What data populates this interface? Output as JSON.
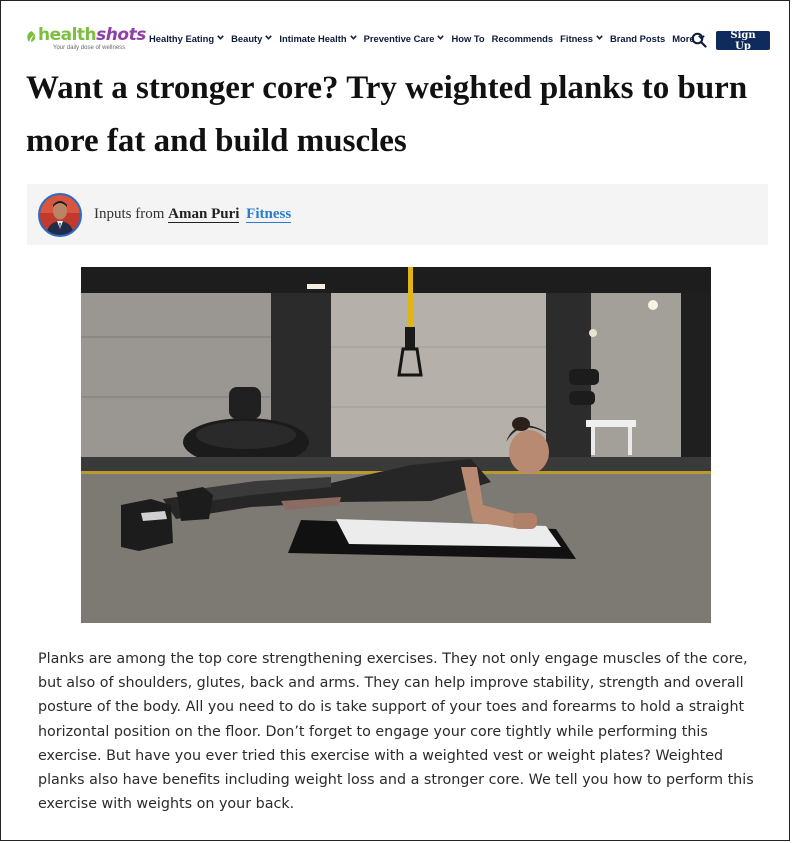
{
  "brand": {
    "name_part1": "health",
    "name_part2": "shots",
    "tagline": "Your daily dose of wellness",
    "green": "#7cbf3f",
    "purple": "#8e3fa8"
  },
  "nav": {
    "items": [
      {
        "label": "Healthy Eating",
        "dropdown": true
      },
      {
        "label": "Beauty",
        "dropdown": true
      },
      {
        "label": "Intimate Health",
        "dropdown": true
      },
      {
        "label": "Preventive Care",
        "dropdown": true
      },
      {
        "label": "How To",
        "dropdown": false
      },
      {
        "label": "Recommends",
        "dropdown": false
      },
      {
        "label": "Fitness",
        "dropdown": true
      },
      {
        "label": "Brand Posts",
        "dropdown": false
      },
      {
        "label": "More",
        "dropdown": true
      }
    ],
    "search_icon": "search-icon",
    "signup_label": "Sign Up",
    "signup_color": "#0f2a5c"
  },
  "article": {
    "headline": "Want a stronger core? Try weighted planks to burn more fat and build muscles",
    "author_prefix": "Inputs from",
    "author_name": "Aman Puri",
    "category": "Fitness",
    "category_color": "#2a7bd0",
    "body": "Planks are among the top core strengthening exercises. They not only engage muscles of the core, but also of shoulders, glutes, back and arms. They can help improve stability, strength and overall posture of the body. All you need to do is take support of your toes and forearms to hold a straight horizontal position on the floor. Don’t forget to engage your core tightly while performing this exercise. But have you ever tried this exercise with a weighted vest or weight plates? Weighted planks also have benefits including weight loss and a stronger core. We tell you how to perform this exercise with weights on your back."
  }
}
